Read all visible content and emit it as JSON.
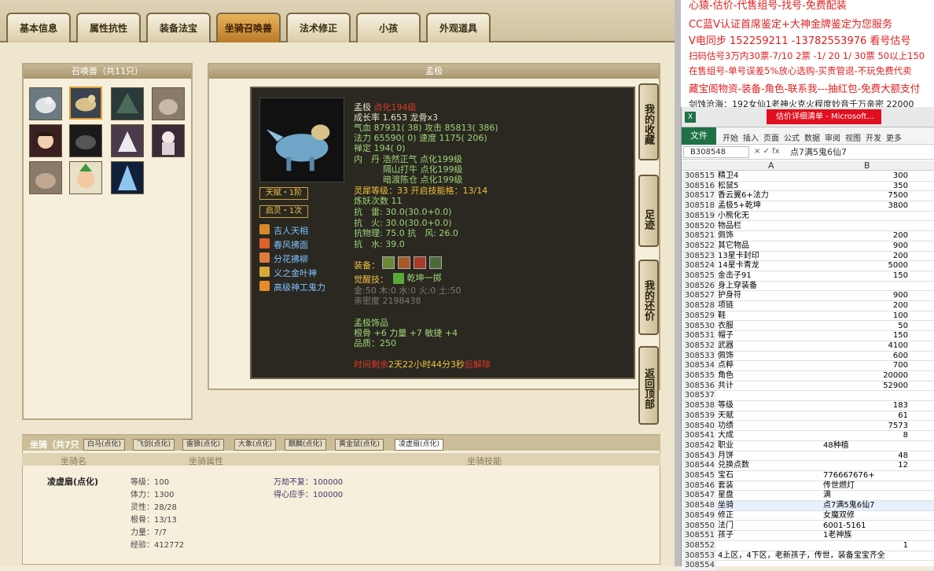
{
  "tabs": [
    "基本信息",
    "属性抗性",
    "装备法宝",
    "坐骑召唤兽",
    "法术修正",
    "小孩",
    "外观道具"
  ],
  "summon_panel_title": "召唤兽（共11只）",
  "detail_title": "孟极",
  "pet": {
    "name": "孟极",
    "name_tag": "点化194级",
    "growth": "成长率 1.653 龙骨x3",
    "hp": "气血 87931( 38) 攻击 85813( 386)",
    "mp": "法力 65590( 0) 速度 1175( 206)",
    "chan": "禅定 194( 0)",
    "neidan1": "内　丹 浩然正气 点化199级",
    "neidan2": "隔山打牛 点化199级",
    "neidan3": "暗渡陈仓 点化199级",
    "soul": "灵犀等级：33 开启技能格：13/14",
    "refine": "炼妖次数 11",
    "res1": "抗　雷: 30.0(30.0+0.0)",
    "res2": "抗　火: 30.0(30.0+0.0)",
    "res3": "抗物理: 75.0 抗　风: 26.0",
    "res4": "抗　水: 39.0",
    "equip_label": "装备：",
    "awaken_label": "觉醒技：",
    "awaken_skill": "乾坤一掷",
    "elements": "金:50 木:0 水:0 火:0 土:50",
    "intimacy": "亲密度 2198438",
    "jewelry_title": "孟极饰品",
    "jewelry_stats": "根骨 +6 力量 +7 敏捷 +4",
    "jewelry_quality": "品质：250",
    "timer_prefix": "时间剩余",
    "timer": "2天22小时44分3秒",
    "timer_suffix": "后解除"
  },
  "talents": [
    "天赋・1阶",
    "启灵・1次"
  ],
  "skills": [
    "吉人天相",
    "春风拂面",
    "分花拂柳",
    "义之金叶神",
    "高级神工鬼力"
  ],
  "side_buttons": [
    "我的收藏",
    "足迹",
    "我的还价",
    "返回顶部"
  ],
  "mount_section": {
    "title": "坐骑（共7只",
    "tabs": [
      "白马(点化)",
      "飞剑(点化)",
      "雷狼(点化)",
      "大象(点化)",
      "麒麟(点化)",
      "黄金鼠(点化)",
      "凌虚扇(点化)"
    ],
    "headers": [
      "坐骑名",
      "坐骑属性",
      "坐骑技能"
    ],
    "name": "凌虚扇(点化)",
    "stats": [
      "等级：100",
      "体力：1300",
      "灵性：28/28",
      "根骨：13/13",
      "力量：7/7",
      "经验：412772"
    ],
    "skills": [
      "万劫不复：100000",
      "得心应手：100000"
    ]
  },
  "overlay": [
    {
      "text": "心猿-估价-代售组号-找号-免费配装",
      "color": "#e02020"
    },
    {
      "text": "CC蓝V认证首席鉴定+大神金牌鉴定为您服务",
      "color": "#e02020"
    },
    {
      "text": "V电同步 152259211 -13782553976 看号估号",
      "color": "#e02020"
    },
    {
      "text": "扫码估号3万内30票-7/10 2票 -1/ 20 1/ 30票 50以上150",
      "color": "#e02020"
    },
    {
      "text": "在售组号-单号误差5%放心选购-买贵管退-不玩免费代卖",
      "color": "#e02020"
    },
    {
      "text": "藏宝阁物资-装备-角色-联系我---抽红包-免费大额支付",
      "color": "#e02020"
    },
    {
      "text": "剑蚀沧海：192女仙1老神火克火程度妙音千万亲密 22000",
      "color": "#222"
    }
  ],
  "excel": {
    "ribbon": [
      "文件",
      "开始",
      "插入",
      "页面",
      "公式",
      "数据",
      "审阅",
      "视图",
      "开发",
      "更多"
    ],
    "title": "估价详细清单 - Microsoft...",
    "cell_ref": "B308548",
    "formula": "点7满5鬼6仙7",
    "col_a": "A",
    "col_b": "B",
    "rows": [
      [
        "308515",
        "精卫4",
        "300"
      ],
      [
        "308516",
        "松鼠5",
        "350"
      ],
      [
        "308517",
        "香云翼6+法力",
        "7500"
      ],
      [
        "308518",
        "孟极5+乾坤",
        "3800"
      ],
      [
        "308519",
        "小熊化无",
        ""
      ],
      [
        "308520",
        "物品栏",
        ""
      ],
      [
        "308521",
        "佩饰",
        "200"
      ],
      [
        "308522",
        "其它物品",
        "900"
      ],
      [
        "308523",
        "13星卡封印",
        "200"
      ],
      [
        "308524",
        "14星卡青龙",
        "5000"
      ],
      [
        "308525",
        "金击子91",
        "150"
      ],
      [
        "308526",
        "身上穿装备",
        ""
      ],
      [
        "308527",
        "护身符",
        "900"
      ],
      [
        "308528",
        "项链",
        "200"
      ],
      [
        "308529",
        "鞋",
        "100"
      ],
      [
        "308530",
        "衣服",
        "50"
      ],
      [
        "308531",
        "帽子",
        "150"
      ],
      [
        "308532",
        "武器",
        "4100"
      ],
      [
        "308533",
        "佩饰",
        "600"
      ],
      [
        "308534",
        "点粹",
        "700"
      ],
      [
        "308535",
        "角色",
        "20000"
      ],
      [
        "308536",
        "共计",
        "52900"
      ],
      [
        "308537",
        "",
        ""
      ],
      [
        "308538",
        "等级",
        "183"
      ],
      [
        "308539",
        "天赋",
        "61"
      ],
      [
        "308540",
        "功绩",
        "7573"
      ],
      [
        "308541",
        "大成",
        "8"
      ],
      [
        "308542",
        "职业",
        "48种植"
      ],
      [
        "308543",
        "月饼",
        "48"
      ],
      [
        "308544",
        "兑换点数",
        "12"
      ],
      [
        "308545",
        "宝石",
        "776667676+"
      ],
      [
        "308546",
        "套装",
        "传世燃灯"
      ],
      [
        "308547",
        "星盘",
        "满"
      ],
      [
        "308548",
        "坐骑",
        "点7满5鬼6仙7"
      ],
      [
        "308549",
        "修正",
        "女魔双修"
      ],
      [
        "308550",
        "法门",
        "6001-5161"
      ],
      [
        "308551",
        "孩子",
        "1老神族"
      ],
      [
        "308552",
        "",
        "1"
      ],
      [
        "308553",
        "4上区，4下区，老新孩子，传世，装备宝宝齐全",
        ""
      ],
      [
        "308554",
        "",
        ""
      ]
    ]
  }
}
